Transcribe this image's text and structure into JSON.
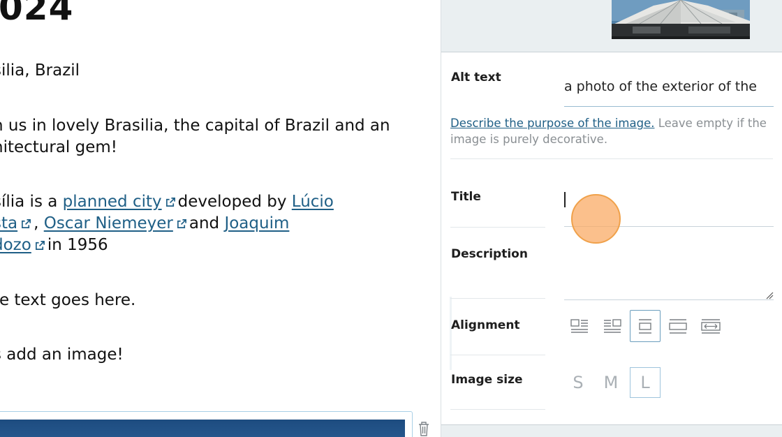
{
  "editor": {
    "title_fragment": "024",
    "location": "silia, Brazil",
    "intro_line1": "n us in lovely Brasilia, the capital of Brazil and an",
    "intro_line2": "nitectural gem!",
    "para": {
      "prefix": "sília is a ",
      "link1": "planned city",
      "mid1": "developed by ",
      "link2a": "Lúcio ",
      "link2b": "sta",
      "comma": ", ",
      "link3": "Oscar Niemeyer",
      "mid2": "and ",
      "link4a": "Joaquim ",
      "link4b": "dozo",
      "suffix": "in 1956"
    },
    "more_text": "re text goes here.",
    "add_image_text": "s add an image!"
  },
  "sidebar": {
    "alt_label": "Alt text",
    "alt_value": "a photo of the exterior of the",
    "help_link": "Describe the purpose of the image.",
    "help_rest": " Leave empty if the image is purely decorative.",
    "title_label": "Title",
    "title_value": "",
    "description_label": "Description",
    "alignment_label": "Alignment",
    "image_size_label": "Image size",
    "alignment_options": [
      "left",
      "right",
      "center",
      "wide",
      "full"
    ],
    "alignment_selected": "center",
    "sizes": [
      "S",
      "M",
      "L"
    ],
    "size_selected": "L"
  },
  "colors": {
    "link": "#1f5f86",
    "panel_bg": "#eaeff1",
    "active_border": "#6a9dbd",
    "click_highlight": "#faa85f"
  },
  "icons": {
    "external": "external-link-icon",
    "trash": "trash-icon",
    "resize": "resize-grip-icon"
  }
}
